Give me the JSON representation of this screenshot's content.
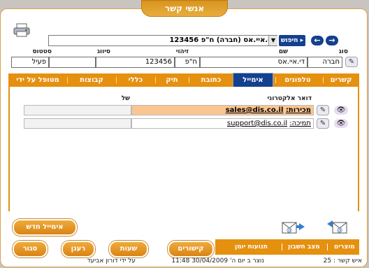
{
  "window": {
    "title": "אנשי קשר"
  },
  "search": {
    "value": "די.איי.אס (חברה) ח\"פ 123456",
    "search_label": "חיפוש",
    "back_glyph": "←",
    "forward_glyph": "→"
  },
  "header_fields": {
    "labels": {
      "type": "סוג",
      "name": "שם",
      "id": "זיהוי",
      "category": "סיווג",
      "status": "סטטוס"
    },
    "values": {
      "type": "חברה",
      "name": "די.איי.אס",
      "id_type": "ח\"פ",
      "id_number": "123456",
      "category": "",
      "status": "פעיל"
    }
  },
  "tabs": [
    {
      "label": "קשרים"
    },
    {
      "label": "טלפונים"
    },
    {
      "label": "אימייל",
      "active": true
    },
    {
      "label": "כתובת"
    },
    {
      "label": "תיק"
    },
    {
      "label": "כללי"
    },
    {
      "label": "קבוצות"
    },
    {
      "label": "מטופל על ידי"
    }
  ],
  "email_table": {
    "col_email": "דואר אלקטרוני",
    "col_owner": "של",
    "rows": [
      {
        "prefix": "מכירות:",
        "address": "sales@dis.co.il",
        "highlighted": true
      },
      {
        "prefix": "תמיכה:",
        "address": "support@dis.co.il",
        "highlighted": false
      }
    ]
  },
  "buttons": {
    "new_email": "אימייל חדש",
    "links": "קישורים",
    "hours": "שעות",
    "refresh": "רענן",
    "close": "סגור"
  },
  "bottom_links": {
    "products": "מוצרים",
    "account_status": "מצב חשבון",
    "journal": "תנועות יומן"
  },
  "status_bar": {
    "contact_number": "איש קשר : 25",
    "created": "נוצר ב יום ה' 30/04/2009 11:48",
    "created_by": "על ידי דורון אביעד"
  },
  "colors": {
    "accent": "#e5900f",
    "active_tab": "#14418f",
    "highlight": "#fbc591"
  }
}
